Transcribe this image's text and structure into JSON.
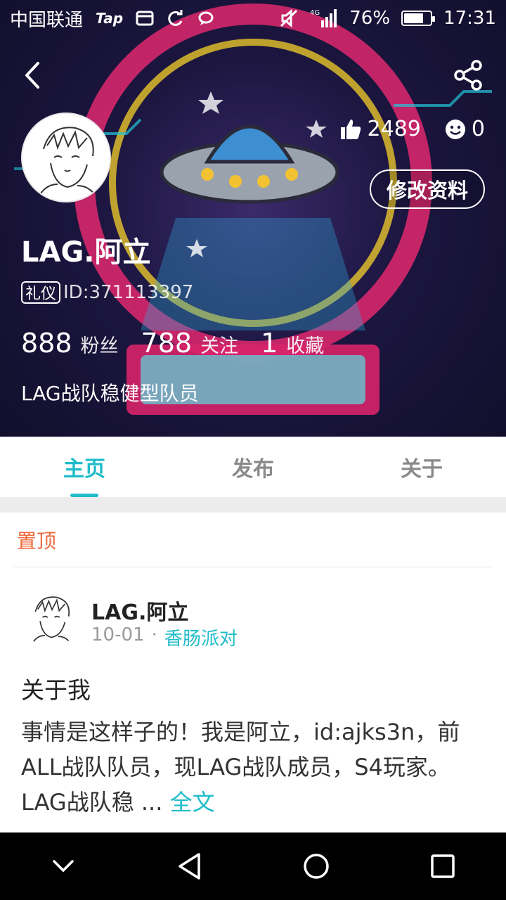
{
  "status_bar": {
    "carrier": "中国联通",
    "tap_label": "Tap",
    "network": "4G",
    "battery": "76%",
    "battery_level": 0.76,
    "time": "17:31"
  },
  "profile": {
    "likes": "2489",
    "smiles": "0",
    "edit_label": "修改资料",
    "username": "LAG.阿立",
    "badge": "礼仪",
    "id_text": "ID:371113397",
    "followers_count": "888",
    "followers_label": "粉丝",
    "following_count": "788",
    "following_label": "关注",
    "favorites_count": "1",
    "favorites_label": "收藏",
    "bio": "LAG战队稳健型队员"
  },
  "tabs": [
    {
      "label": "主页",
      "active": true
    },
    {
      "label": "发布",
      "active": false
    },
    {
      "label": "关于",
      "active": false
    }
  ],
  "pinned_label": "置顶",
  "post": {
    "author": "LAG.阿立",
    "date": "10-01",
    "separator": "·",
    "game": "香肠派对",
    "title": "关于我",
    "body": "事情是这样子的！我是阿立，id:ajks3n，前ALL战队队员，现LAG战队成员，S4玩家。LAG战队稳 ...",
    "more": "全文"
  },
  "colors": {
    "accent": "#1fbcc9",
    "pinned": "#ef6a3c",
    "header_bg": "#1c1640"
  },
  "icons": [
    "back-icon",
    "share-icon",
    "thumbs-up-icon",
    "smile-icon",
    "mute-icon",
    "signal-icon",
    "battery-icon",
    "nav-down-icon",
    "nav-back-icon",
    "nav-home-icon",
    "nav-recent-icon"
  ]
}
